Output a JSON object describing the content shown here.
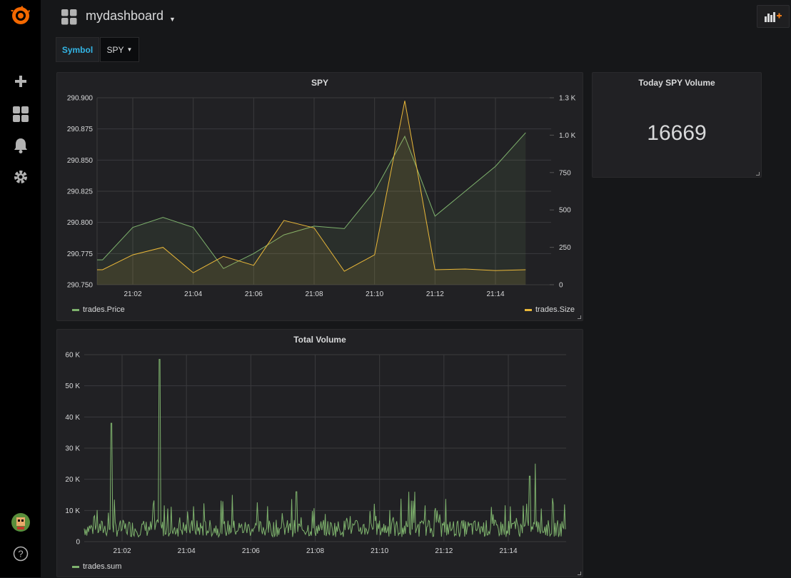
{
  "dashboard": {
    "title": "mydashboard"
  },
  "variables": {
    "label": "Symbol",
    "value": "SPY"
  },
  "panels": {
    "spy": {
      "title": "SPY",
      "legend_left": "trades.Price",
      "legend_right": "trades.Size"
    },
    "stat": {
      "title": "Today SPY Volume",
      "value": "16669"
    },
    "volume": {
      "title": "Total Volume",
      "legend": "trades.sum"
    }
  },
  "colors": {
    "price": "#7eb26d",
    "size": "#eab839",
    "accent": "#33b5e5",
    "logo": "#f46800"
  },
  "sidebar": {
    "items": [
      "grafana-logo-icon",
      "plus-icon",
      "dashboards-icon",
      "bell-icon",
      "gear-icon",
      "user-avatar-icon",
      "help-icon"
    ]
  },
  "chart_data": [
    {
      "type": "line",
      "title": "SPY",
      "x": [
        "21:00:30",
        "21:01",
        "21:02",
        "21:03",
        "21:04",
        "21:05",
        "21:06",
        "21:07",
        "21:08",
        "21:09",
        "21:10",
        "21:11",
        "21:12",
        "21:13",
        "21:14",
        "21:15"
      ],
      "x_ticks": [
        "21:02",
        "21:04",
        "21:06",
        "21:08",
        "21:10",
        "21:12",
        "21:14"
      ],
      "series": [
        {
          "name": "trades.Price",
          "axis": "left",
          "values": [
            290.77,
            290.77,
            290.796,
            290.804,
            290.796,
            290.763,
            290.775,
            290.79,
            290.797,
            290.795,
            290.825,
            290.869,
            290.805,
            290.825,
            290.845,
            290.872
          ]
        },
        {
          "name": "trades.Size",
          "axis": "right",
          "values": [
            100,
            100,
            200,
            250,
            80,
            190,
            130,
            430,
            380,
            90,
            200,
            1230,
            100,
            105,
            95,
            100
          ]
        }
      ],
      "y_left_ticks": [
        "290.750",
        "290.775",
        "290.800",
        "290.825",
        "290.850",
        "290.875",
        "290.900"
      ],
      "y_left_range": [
        290.75,
        290.9
      ],
      "y_right_ticks": [
        "0",
        "250",
        "500",
        "750",
        "1.0 K",
        "1.3 K"
      ],
      "y_right_range": [
        0,
        1250
      ],
      "grid": true,
      "legend": "bottom"
    },
    {
      "type": "line",
      "title": "Total Volume",
      "x_ticks": [
        "21:02",
        "21:04",
        "21:06",
        "21:08",
        "21:10",
        "21:12",
        "21:14"
      ],
      "x_range": [
        "21:00:30",
        "21:15:40"
      ],
      "series": [
        {
          "name": "trades.sum",
          "spikes": [
            {
              "t": "21:01:40",
              "v": 38000
            },
            {
              "t": "21:03:10",
              "v": 58500
            },
            {
              "t": "21:11:05",
              "v": 16000
            },
            {
              "t": "21:14:50",
              "v": 25000
            },
            {
              "t": "21:14:40",
              "v": 21000
            },
            {
              "t": "21:07:25",
              "v": 16000
            },
            {
              "t": "21:05:25",
              "v": 15000
            },
            {
              "t": "21:10:55",
              "v": 16000
            }
          ],
          "baseline_range": [
            0,
            10000
          ]
        }
      ],
      "y_ticks": [
        "0",
        "10 K",
        "20 K",
        "30 K",
        "40 K",
        "50 K",
        "60 K"
      ],
      "y_range": [
        0,
        60000
      ],
      "grid": true,
      "legend": "bottom"
    }
  ]
}
